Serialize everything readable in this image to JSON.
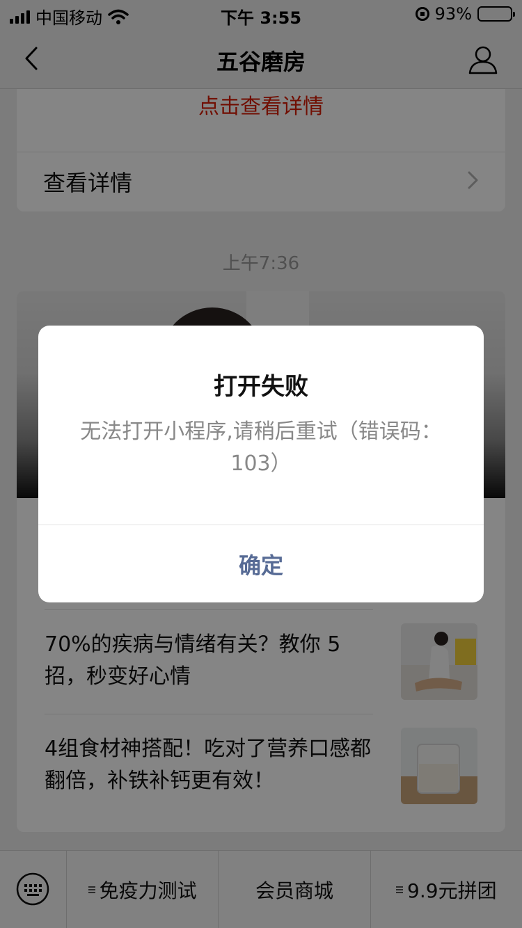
{
  "status_bar": {
    "carrier": "中国移动",
    "time": "下午 3:55",
    "battery_percent": "93%",
    "battery_level": 0.93
  },
  "nav": {
    "title": "五谷磨房"
  },
  "message_card": {
    "red_link": "点击查看详情",
    "detail_label": "查看详情"
  },
  "timestamp": "上午7:36",
  "articles": [
    {
      "title": "70%的疾病与情绪有关？教你 5 招，秒变好心情"
    },
    {
      "title": "4组食材神搭配！吃对了营养口感都翻倍，补铁补钙更有效！"
    }
  ],
  "bottom_menu": {
    "items": [
      {
        "label": "免疫力测试",
        "has_submenu": true
      },
      {
        "label": "会员商城",
        "has_submenu": false
      },
      {
        "label": "9.9元拼团",
        "has_submenu": true
      }
    ]
  },
  "dialog": {
    "title": "打开失败",
    "message": "无法打开小程序,请稍后重试（错误码：103）",
    "confirm_label": "确定"
  },
  "colors": {
    "link_red": "#d81e06",
    "dialog_button": "#576b95",
    "overlay": "rgba(0,0,0,0.48)"
  }
}
